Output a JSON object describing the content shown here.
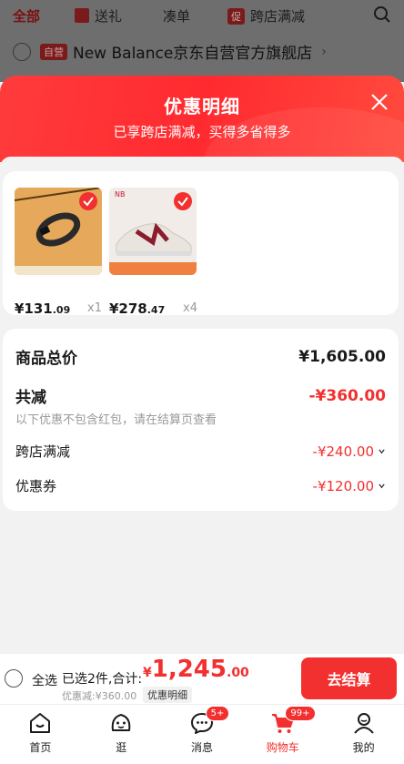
{
  "background": {
    "tabs": [
      "全部",
      "送礼",
      "凑单",
      "跨店满减"
    ],
    "tab_badge": "促",
    "store_badge": "自营",
    "store_name": "New Balance京东自营官方旗舰店"
  },
  "popup": {
    "title": "优惠明细",
    "subtitle": "已享跨店满减，买得多省得多"
  },
  "products": [
    {
      "price_int": "¥131",
      "price_dec": ".09",
      "qty": "x1"
    },
    {
      "price_int": "¥278",
      "price_dec": ".47",
      "qty": "x4"
    }
  ],
  "summary": {
    "total_label": "商品总价",
    "total_value": "¥1,605.00",
    "discount_label": "共减",
    "discount_value": "-¥360.00",
    "note": "以下优惠不包含红包，请在结算页查看",
    "items": [
      {
        "label": "跨店满减",
        "value": "-¥240.00"
      },
      {
        "label": "优惠券",
        "value": "-¥120.00"
      }
    ]
  },
  "checkout": {
    "select_all": "全选",
    "selected_text": "已选2件,合计:",
    "total_currency": "¥",
    "total_int": "1,245",
    "total_dec": ".00",
    "discount_text": "优惠减:¥360.00",
    "detail_button": "优惠明细",
    "checkout_button": "去结算"
  },
  "nav": [
    {
      "label": "首页",
      "icon": "home-icon"
    },
    {
      "label": "逛",
      "icon": "explore-icon"
    },
    {
      "label": "消息",
      "icon": "message-icon",
      "badge": "5+"
    },
    {
      "label": "购物车",
      "icon": "cart-icon",
      "badge": "99+",
      "active": true
    },
    {
      "label": "我的",
      "icon": "profile-icon"
    }
  ],
  "colors": {
    "accent": "#f2302f",
    "header_gradient_start": "#ff3b3b"
  }
}
